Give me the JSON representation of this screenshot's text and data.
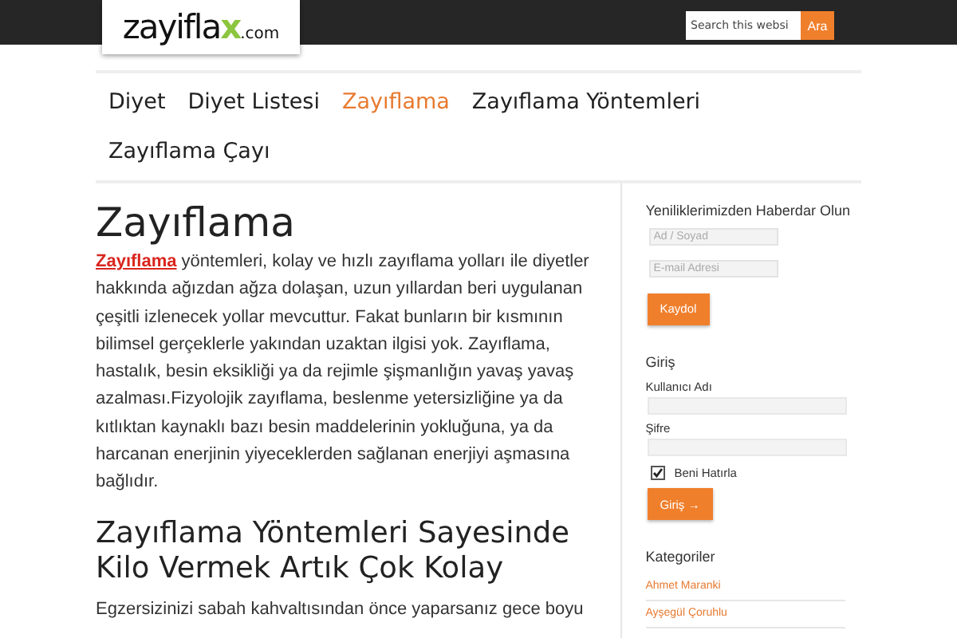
{
  "header": {
    "logo": {
      "main": "zayifla",
      "accent": "x",
      "suffix": ".com"
    },
    "search": {
      "placeholder": "Search this websi",
      "button": "Ara"
    }
  },
  "nav": [
    {
      "label": "Diyet",
      "selected": false
    },
    {
      "label": "Diyet Listesi",
      "selected": false
    },
    {
      "label": "Zayıflama",
      "selected": true
    },
    {
      "label": "Zayıflama Yöntemleri",
      "selected": false
    },
    {
      "label": "Zayıflama Çayı",
      "selected": false
    }
  ],
  "article": {
    "title": "Zayıflama",
    "intro_link": "Zayıflama",
    "intro": " yöntemleri, kolay ve hızlı zayıflama yolları ile diyetler hakkında ağızdan ağza dolaşan, uzun yıllardan beri uygulanan çeşitli izlenecek yollar mevcuttur. Fakat bunların bir kısmının bilimsel gerçeklerle yakından uzaktan ilgisi yok. Zayıflama, hastalık, besin eksikliği ya da rejimle şişmanlığın yavaş yavaş azalması.Fizyolojik zayıflama, beslenme yetersizliğine ya da kıtlıktan kaynaklı bazı besin maddelerinin yokluğuna, ya da harcanan enerjinin yiyeceklerden sağlanan enerjiyi aşmasına bağlıdır.",
    "subtitle": "Zayıflama Yöntemleri Sayesinde Kilo Vermek Artık Çok Kolay",
    "paragraph": "Egzersizinizi sabah kahvaltısından önce yaparsanız gece boyu"
  },
  "sidebar": {
    "newsletter": {
      "title": "Yeniliklerimizden Haberdar Olun",
      "fields": [
        {
          "placeholder": "Ad / Soyad"
        },
        {
          "placeholder": "E-mail Adresi"
        }
      ],
      "button": "Kaydol"
    },
    "login": {
      "title": "Giriş",
      "user_label": "Kullanıcı Adı",
      "password_label": "Şifre",
      "remember": {
        "label": "Beni Hatırla",
        "checked": true
      },
      "button": "Giriş →"
    },
    "categories": {
      "title": "Kategoriler",
      "items": [
        "Ahmet Maranki",
        "Ayşegül Çoruhlu"
      ]
    }
  }
}
